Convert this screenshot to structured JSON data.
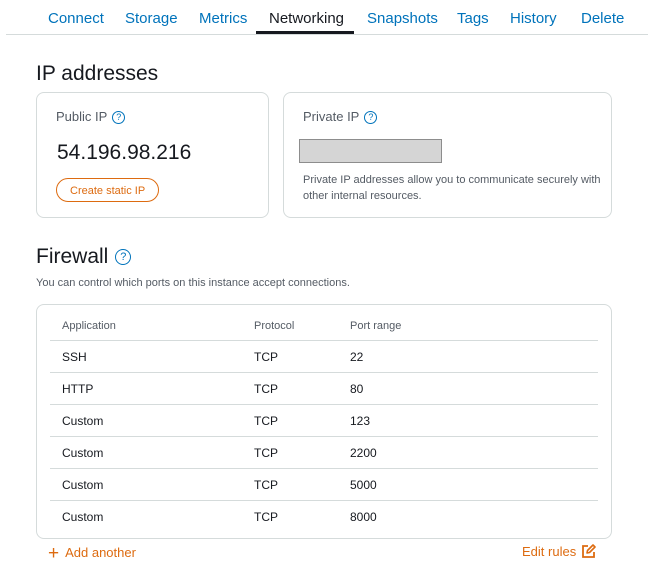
{
  "tabs": [
    {
      "label": "Connect"
    },
    {
      "label": "Storage"
    },
    {
      "label": "Metrics"
    },
    {
      "label": "Networking"
    },
    {
      "label": "Snapshots"
    },
    {
      "label": "Tags"
    },
    {
      "label": "History"
    },
    {
      "label": "Delete"
    }
  ],
  "active_tab": "Networking",
  "ip_section": {
    "title": "IP addresses",
    "public": {
      "label": "Public IP",
      "value": "54.196.98.216",
      "button_label": "Create static IP"
    },
    "private": {
      "label": "Private IP",
      "description": "Private IP addresses allow you to communicate securely with other internal resources."
    }
  },
  "firewall": {
    "title": "Firewall",
    "description": "You can control which ports on this instance accept connections.",
    "columns": [
      "Application",
      "Protocol",
      "Port range"
    ],
    "rows": [
      [
        "SSH",
        "TCP",
        "22"
      ],
      [
        "HTTP",
        "TCP",
        "80"
      ],
      [
        "Custom",
        "TCP",
        "123"
      ],
      [
        "Custom",
        "TCP",
        "2200"
      ],
      [
        "Custom",
        "TCP",
        "5000"
      ],
      [
        "Custom",
        "TCP",
        "8000"
      ]
    ],
    "add_label": "Add another",
    "edit_label": "Edit rules"
  },
  "icons": {
    "help": "help-circle-icon",
    "add": "plus-icon",
    "edit": "edit-icon"
  },
  "colors": {
    "link": "#0073bb",
    "accent": "#dd6b10",
    "text": "#16191f",
    "muted": "#545b64",
    "border": "#d5dbdb"
  }
}
